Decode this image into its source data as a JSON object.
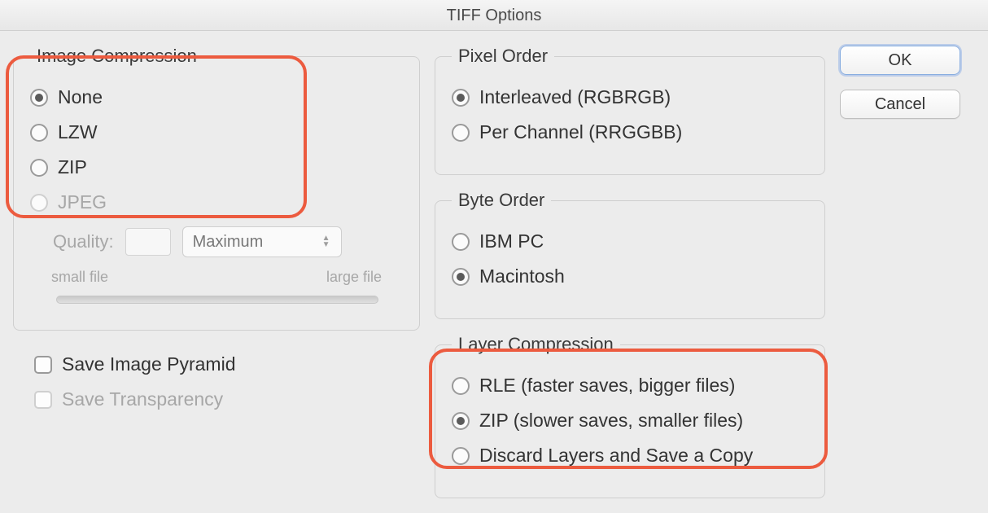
{
  "title": "TIFF Options",
  "buttons": {
    "ok": "OK",
    "cancel": "Cancel"
  },
  "imageCompression": {
    "legend": "Image Compression",
    "options": {
      "none": "None",
      "lzw": "LZW",
      "zip": "ZIP",
      "jpeg": "JPEG"
    },
    "selected": "none",
    "quality": {
      "label": "Quality:",
      "value": "",
      "preset": "Maximum",
      "leftLabel": "small file",
      "rightLabel": "large file"
    }
  },
  "pixelOrder": {
    "legend": "Pixel Order",
    "options": {
      "interleaved": "Interleaved (RGBRGB)",
      "perChannel": "Per Channel (RRGGBB)"
    },
    "selected": "interleaved"
  },
  "byteOrder": {
    "legend": "Byte Order",
    "options": {
      "ibm": "IBM PC",
      "mac": "Macintosh"
    },
    "selected": "mac"
  },
  "layerCompression": {
    "legend": "Layer Compression",
    "options": {
      "rle": "RLE (faster saves, bigger files)",
      "zip": "ZIP (slower saves, smaller files)",
      "discard": "Discard Layers and Save a Copy"
    },
    "selected": "zip"
  },
  "checks": {
    "saveImagePyramid": {
      "label": "Save Image Pyramid",
      "checked": false,
      "enabled": true
    },
    "saveTransparency": {
      "label": "Save Transparency",
      "checked": false,
      "enabled": false
    }
  }
}
